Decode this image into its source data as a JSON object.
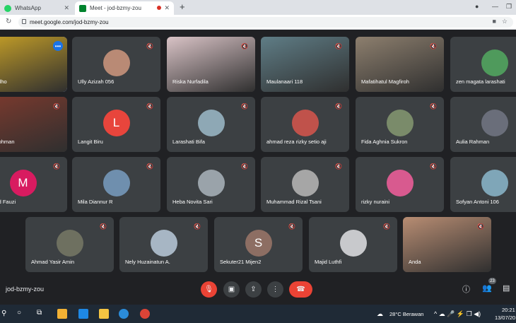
{
  "browser": {
    "tabs": [
      {
        "title": "WhatsApp"
      },
      {
        "title": "Meet - jod-bzmy-zou"
      }
    ],
    "url": "meet.google.com/jod-bzmy-zou"
  },
  "participants": [
    {
      "name": "Murtadho",
      "style": "video",
      "color": "#c9a227"
    },
    {
      "name": "Ully Azizah 056",
      "style": "avatar",
      "color": "#b98a75"
    },
    {
      "name": "Riska Nurfadila",
      "style": "video",
      "color": "#d9c3c6"
    },
    {
      "name": "Maulanaari 118",
      "style": "video",
      "color": "#5f7d86"
    },
    {
      "name": "Mafatihatul Magfiroh",
      "style": "video",
      "color": "#8d7f6e"
    },
    {
      "name": "zen magata larashati",
      "style": "avatar",
      "color": "#4f9a5c"
    },
    {
      "name": "Nur Rohman",
      "style": "video",
      "color": "#7d3a2e"
    },
    {
      "name": "Langit Biru",
      "style": "letter",
      "letter": "L",
      "color": "#e8453c"
    },
    {
      "name": "Larashati Bifa",
      "style": "avatar",
      "color": "#8ea8b5"
    },
    {
      "name": "ahmad reza rizky setio aji",
      "style": "avatar",
      "color": "#c0524b"
    },
    {
      "name": "Fida Aghnia Sukron",
      "style": "avatar",
      "color": "#7a8b6a"
    },
    {
      "name": "Aulia Rahman",
      "style": "avatar",
      "color": "#6a6e7a"
    },
    {
      "name": "Ahmad Fauzi",
      "style": "letter",
      "letter": "M",
      "color": "#d81b60"
    },
    {
      "name": "Mila Diannur R",
      "style": "avatar",
      "color": "#6f8fae"
    },
    {
      "name": "Heba Novita Sari",
      "style": "avatar",
      "color": "#9aa3aa"
    },
    {
      "name": "Muhammad Rizal Tsani",
      "style": "avatar",
      "color": "#a6a6a6"
    },
    {
      "name": "rizky nuraini",
      "style": "avatar",
      "color": "#d85a8f"
    },
    {
      "name": "Sofyan Antoni 106",
      "style": "avatar",
      "color": "#7fa6b8"
    },
    {
      "name": "Ahmad Yasir Amin",
      "style": "avatar",
      "color": "#6e7060"
    },
    {
      "name": "Nely Huzainatun A.",
      "style": "avatar",
      "color": "#a7b6c4"
    },
    {
      "name": "Sekuter21 Mijen2",
      "style": "letter",
      "letter": "S",
      "color": "#8d6e63"
    },
    {
      "name": "Majid Luthfi",
      "style": "avatar",
      "color": "#c8c9cc"
    },
    {
      "name": "Anda",
      "style": "video",
      "color": "#b88d73"
    }
  ],
  "meeting": {
    "code": "jod-bzmy-zou",
    "people_count": "23"
  },
  "taskbar": {
    "weather": "28°C Berawan",
    "time": "20:21",
    "date": "13/07/20"
  }
}
